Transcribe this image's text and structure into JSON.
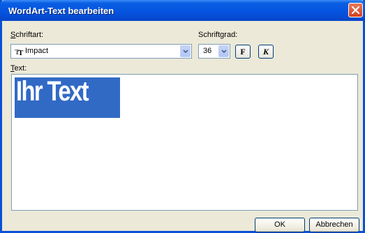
{
  "window": {
    "title": "WordArt-Text bearbeiten"
  },
  "font": {
    "label_u": "S",
    "label_rest": "chriftart:",
    "value": "Impact",
    "icon": "truetype-font-icon"
  },
  "size": {
    "label": "Schriftgrad:",
    "value": "36"
  },
  "format": {
    "bold_label": "F",
    "italic_label": "K"
  },
  "text": {
    "label_u": "T",
    "label_rest": "ext:",
    "content": "Ihr Text"
  },
  "buttons": {
    "ok": "OK",
    "cancel": "Abbrechen"
  },
  "colors": {
    "titlebar": "#0553df",
    "selection": "#316ac5",
    "close": "#d5411c"
  }
}
